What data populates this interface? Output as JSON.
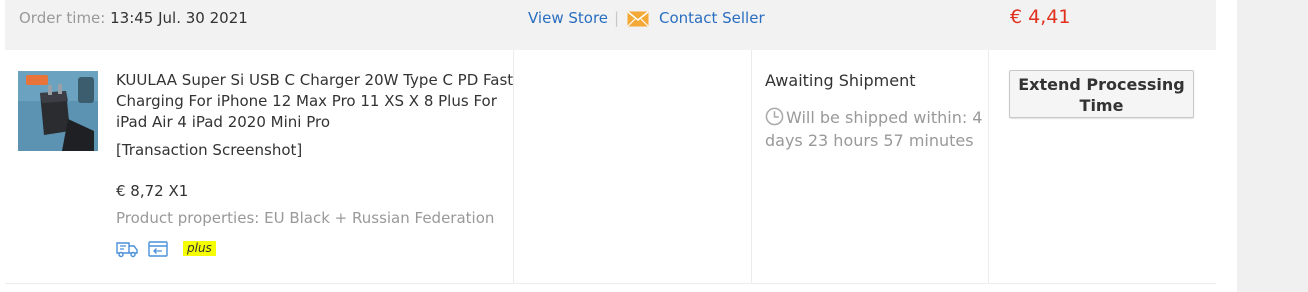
{
  "order": {
    "time_label": "Order time:",
    "time_value": "13:45 Jul. 30 2021",
    "view_store": "View Store",
    "separator": "|",
    "contact_seller": "Contact Seller",
    "total": "€ 4,41"
  },
  "item": {
    "title": "KUULAA Super Si USB C Charger 20W Type C PD Fast Charging For iPhone 12 Max Pro 11 XS X 8 Plus For iPad Air 4 iPad 2020 Mini Pro",
    "transaction_screenshot": "[Transaction Screenshot]",
    "price": "€ 8,72 X1",
    "properties": "Product properties: EU Black + Russian Federation",
    "badge": "plus",
    "status": "Awaiting Shipment",
    "ship_info": "Will be shipped within: 4 days 23 hours 57 minutes",
    "extend_button": "Extend Processing Time"
  },
  "icons": {
    "mail": "mail-icon",
    "truck": "truck-icon",
    "return": "return-icon",
    "clock": "clock-icon"
  },
  "colors": {
    "link": "#2a6ec0",
    "price": "#e0301e",
    "badge": "#f6ff00",
    "mail_icon": "#f4a836"
  }
}
